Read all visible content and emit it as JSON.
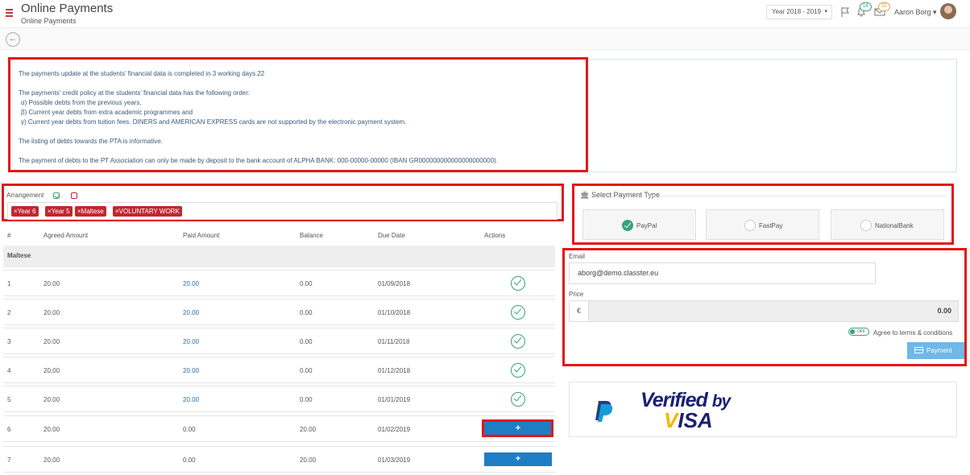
{
  "header": {
    "title": "Online Payments",
    "subtitle": "Online Payments",
    "year": "Year 2018 - 2019",
    "badge_green": "14",
    "badge_orange": "35",
    "user": "Aaron Borg"
  },
  "info": {
    "p1": "The payments update at the students’ financial data is completed in 3 working days.22",
    "p2": "The payments’ credit policy at the students’ financial data has the following order:",
    "p3": "α) Possible debts from the previous years,",
    "p4": "β) Current year debts from extra academic programmes and",
    "p5": "γ) Current year debts from tuition fees. DINERS and AMERICAN EXPRESS cards are not supported by the electronic payment system.",
    "p6": "The listing of debts towards the PTA is informative.",
    "p7": "The payment of debts to the PT Association can only be made by deposit to the bank account of ALPHA BANK: 000-00000-00000 (IBAN GR000000000000000000000)."
  },
  "arrangement": {
    "label": "Arrangement",
    "tags": [
      "×Year 6",
      "×Year 5",
      "×Maltese",
      "×VOLUNTARY WORK"
    ]
  },
  "table": {
    "headers": [
      "#",
      "Agreed Amount",
      "Paid Amount",
      "Balance",
      "Due Date",
      "Actions"
    ],
    "group": "Maltese",
    "rows": [
      {
        "n": "1",
        "agreed": "20.00",
        "paid": "20.00",
        "balance": "0.00",
        "due": "01/09/2018"
      },
      {
        "n": "2",
        "agreed": "20.00",
        "paid": "20.00",
        "balance": "0.00",
        "due": "01/10/2018"
      },
      {
        "n": "3",
        "agreed": "20.00",
        "paid": "20.00",
        "balance": "0.00",
        "due": "01/11/2018"
      },
      {
        "n": "4",
        "agreed": "20.00",
        "paid": "20.00",
        "balance": "0.00",
        "due": "01/12/2018"
      },
      {
        "n": "5",
        "agreed": "20.00",
        "paid": "20.00",
        "balance": "0.00",
        "due": "01/01/2019"
      },
      {
        "n": "6",
        "agreed": "20.00",
        "paid": "0.00",
        "balance": "20.00",
        "due": "01/02/2019"
      },
      {
        "n": "7",
        "agreed": "20.00",
        "paid": "0.00",
        "balance": "20.00",
        "due": "01/03/2019"
      }
    ],
    "plus": "+"
  },
  "payment_type": {
    "title": "Select Payment Type",
    "options": [
      "PayPal",
      "FastPay",
      "NationalBank"
    ],
    "selected": "PayPal"
  },
  "form": {
    "email_label": "Email",
    "email_value": "aborg@demo.classter.eu",
    "price_label": "Price",
    "currency": "€",
    "price_value": "0.00",
    "toggle": "OFF",
    "terms": "Agree to terms & conditions",
    "pay_button": "Payment"
  },
  "logos": {
    "vbv_line1": "Verified",
    "vbv_by": "by",
    "vbv_v": "V",
    "vbv_rest": "ISA"
  },
  "colors": {
    "accent_red": "#e01818",
    "tag_red": "#c0282f",
    "green": "#3aa27b",
    "blue_button": "#1f7dc4",
    "pay_button": "#6fb8e8",
    "visa_blue": "#1a1f71"
  }
}
